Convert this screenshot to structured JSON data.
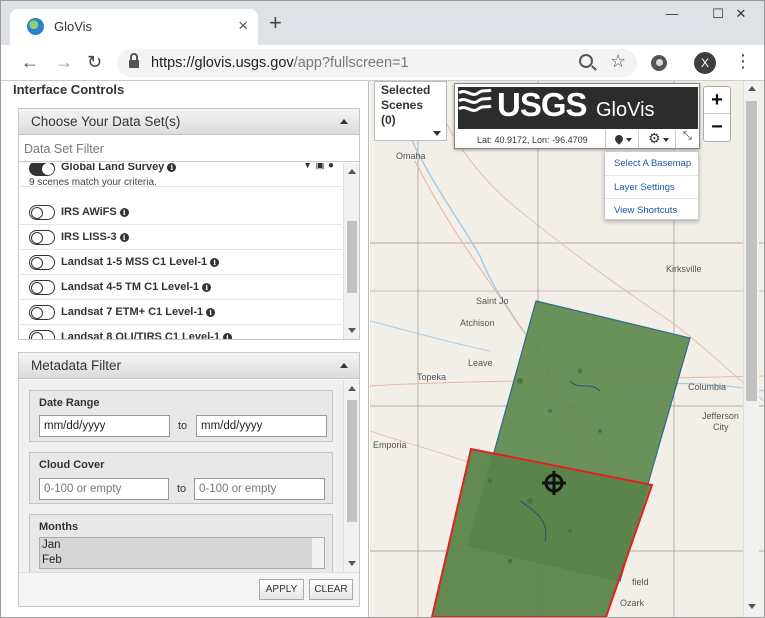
{
  "browser": {
    "tab_title": "GloVis",
    "tab_close": "×",
    "new_tab": "+",
    "win_min": "—",
    "win_max": "☐",
    "win_close": "✕",
    "back": "←",
    "forward": "→",
    "reload": "↻",
    "url_host": "https://glovis.usgs.gov",
    "url_path": "/app?fullscreen=1",
    "star": "☆",
    "avatar_letter": "X",
    "menu": "⋮"
  },
  "interface_controls": {
    "title": "Interface Controls"
  },
  "datasets": {
    "header": "Choose Your Data Set(s)",
    "filter_placeholder": "Data Set Filter",
    "items": [
      {
        "label": "Global Land Survey",
        "enabled": true,
        "sub": "9 scenes match your criteria."
      },
      {
        "label": "IRS AWiFS",
        "enabled": false
      },
      {
        "label": "IRS LISS-3",
        "enabled": false
      },
      {
        "label": "Landsat 1-5 MSS C1 Level-1",
        "enabled": false
      },
      {
        "label": "Landsat 4-5 TM C1 Level-1",
        "enabled": false
      },
      {
        "label": "Landsat 7 ETM+ C1 Level-1",
        "enabled": false
      },
      {
        "label": "Landsat 8 OLI/TIRS C1 Level-1",
        "enabled": false
      }
    ],
    "row_icons": [
      "filter-icon",
      "image-icon",
      "globe-icon"
    ],
    "info_glyph": "i"
  },
  "metadata": {
    "header": "Metadata Filter",
    "date_range": {
      "label": "Date Range",
      "from_placeholder": "mm/dd/yyyy",
      "to_label": "to",
      "to_placeholder": "mm/dd/yyyy"
    },
    "cloud_cover": {
      "label": "Cloud Cover",
      "from_placeholder": "0-100 or empty",
      "to_label": "to",
      "to_placeholder": "0-100 or empty"
    },
    "months": {
      "label": "Months",
      "options": [
        "Jan",
        "Feb"
      ]
    },
    "apply_label": "APPLY",
    "clear_label": "CLEAR"
  },
  "map": {
    "selected_scenes_label": "Selected Scenes",
    "selected_scenes_count": "(0)",
    "logo_text": "USGS",
    "logo_app": "GloVis",
    "coordinates": "Lat: 40.9172, Lon: -96.4709",
    "basemap_menu": [
      "Select A Basemap",
      "Layer Settings",
      "View Shortcuts"
    ],
    "zoom_in": "+",
    "zoom_out": "−",
    "cities": [
      "Omaha",
      "Kirksville",
      "Saint Jo",
      "Atchison",
      "Leave",
      "Topeka",
      "Columbia",
      "Jefferson",
      "City",
      "Emporia",
      "field",
      "Ozark"
    ],
    "colors": {
      "scene_fill": "#5f8a4e",
      "scene_outline": "#e22222",
      "land": "#f2efe9",
      "water": "#a9cce3"
    }
  }
}
